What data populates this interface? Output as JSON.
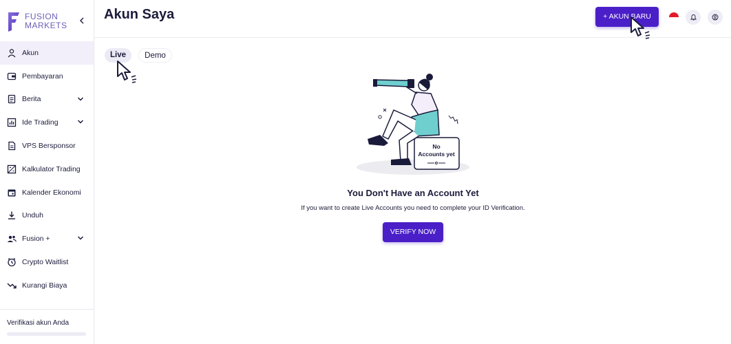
{
  "brand": {
    "line1": "FUSION",
    "line2": "MARKETS",
    "accent": "#6a5fb8"
  },
  "sidebar": {
    "items": [
      {
        "label": "Akun",
        "icon": "user-icon",
        "active": true,
        "expandable": false
      },
      {
        "label": "Pembayaran",
        "icon": "wallet-icon",
        "active": false,
        "expandable": false
      },
      {
        "label": "Berita",
        "icon": "news-icon",
        "active": false,
        "expandable": true
      },
      {
        "label": "Ide Trading",
        "icon": "chart-icon",
        "active": false,
        "expandable": true
      },
      {
        "label": "VPS Bersponsor",
        "icon": "document-icon",
        "active": false,
        "expandable": false
      },
      {
        "label": "Kalkulator Trading",
        "icon": "calculator-icon",
        "active": false,
        "expandable": false
      },
      {
        "label": "Kalender Ekonomi",
        "icon": "calendar-icon",
        "active": false,
        "expandable": false
      },
      {
        "label": "Unduh",
        "icon": "download-icon",
        "active": false,
        "expandable": false
      },
      {
        "label": "Fusion +",
        "icon": "users-icon",
        "active": false,
        "expandable": true
      },
      {
        "label": "Crypto Waitlist",
        "icon": "clock-icon",
        "active": false,
        "expandable": false
      },
      {
        "label": "Kurangi Biaya",
        "icon": "trend-down-icon",
        "active": false,
        "expandable": false
      }
    ],
    "verify": {
      "label": "Verifikasi akun Anda",
      "progress": 0
    }
  },
  "header": {
    "title": "Akun Saya",
    "new_account_label": "+ AKUN BARU",
    "language_flag": "indonesia-flag-icon"
  },
  "tabs": [
    {
      "label": "Live",
      "selected": true
    },
    {
      "label": "Demo",
      "selected": false
    }
  ],
  "empty_state": {
    "badge_line1": "No",
    "badge_line2": "Accounts yet",
    "title": "You Don't Have an Account Yet",
    "text": "If you want to create Live Accounts you need to complete your ID Verification.",
    "button_label": "VERIFY NOW"
  },
  "colors": {
    "primary": "#4a1fc8",
    "active_bg": "#f2effa",
    "text": "#1a1b3a",
    "illustration_teal": "#6fcfcf"
  }
}
